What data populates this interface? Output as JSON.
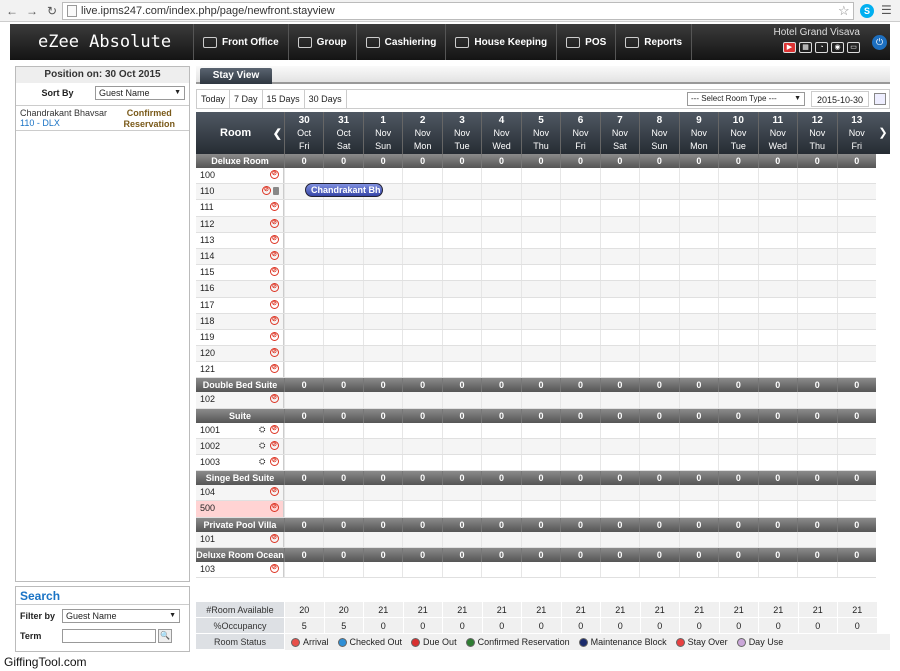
{
  "browser": {
    "url": "live.ipms247.com/index.php/page/newfront.stayview"
  },
  "app": {
    "logo": "eZee Absolute",
    "hotel_name": "Hotel Grand Visava",
    "nav": [
      {
        "label": "Front Office",
        "icon": "front-office-icon"
      },
      {
        "label": "Group",
        "icon": "group-icon"
      },
      {
        "label": "Cashiering",
        "icon": "cashiering-icon"
      },
      {
        "label": "House Keeping",
        "icon": "housekeeping-icon"
      },
      {
        "label": "POS",
        "icon": "pos-icon"
      },
      {
        "label": "Reports",
        "icon": "reports-icon"
      }
    ]
  },
  "left": {
    "position_label": "Position on: 30 Oct 2015",
    "sort_label": "Sort By",
    "sort_value": "Guest Name",
    "reservation": {
      "guest": "Chandrakant Bhavsar",
      "room": "110 - DLX",
      "status_line1": "Confirmed",
      "status_line2": "Reservation"
    }
  },
  "search": {
    "title": "Search",
    "filter_label": "Filter by",
    "filter_value": "Guest Name",
    "term_label": "Term",
    "term_value": ""
  },
  "stayview": {
    "tab": "Stay View",
    "view_buttons": [
      "Today",
      "7 Day",
      "15 Days",
      "30 Days"
    ],
    "room_type_placeholder": "--- Select Room Type ---",
    "date": "2015-10-30",
    "room_header": "Room",
    "days": [
      {
        "n": "30",
        "m": "Oct",
        "w": "Fri"
      },
      {
        "n": "31",
        "m": "Oct",
        "w": "Sat"
      },
      {
        "n": "1",
        "m": "Nov",
        "w": "Sun"
      },
      {
        "n": "2",
        "m": "Nov",
        "w": "Mon"
      },
      {
        "n": "3",
        "m": "Nov",
        "w": "Tue"
      },
      {
        "n": "4",
        "m": "Nov",
        "w": "Wed"
      },
      {
        "n": "5",
        "m": "Nov",
        "w": "Thu"
      },
      {
        "n": "6",
        "m": "Nov",
        "w": "Fri"
      },
      {
        "n": "7",
        "m": "Nov",
        "w": "Sat"
      },
      {
        "n": "8",
        "m": "Nov",
        "w": "Sun"
      },
      {
        "n": "9",
        "m": "Nov",
        "w": "Mon"
      },
      {
        "n": "10",
        "m": "Nov",
        "w": "Tue"
      },
      {
        "n": "11",
        "m": "Nov",
        "w": "Wed"
      },
      {
        "n": "12",
        "m": "Nov",
        "w": "Thu"
      },
      {
        "n": "13",
        "m": "Nov",
        "w": "Fri"
      }
    ],
    "groups": [
      {
        "name": "Deluxe Room",
        "counts": [
          "0",
          "0",
          "0",
          "0",
          "0",
          "0",
          "0",
          "0",
          "0",
          "0",
          "0",
          "0",
          "0",
          "0",
          "0"
        ],
        "rooms": [
          {
            "no": "100"
          },
          {
            "no": "110",
            "lock": true
          },
          {
            "no": "111"
          },
          {
            "no": "112"
          },
          {
            "no": "113"
          },
          {
            "no": "114"
          },
          {
            "no": "115"
          },
          {
            "no": "116"
          },
          {
            "no": "117"
          },
          {
            "no": "118"
          },
          {
            "no": "119"
          },
          {
            "no": "120"
          },
          {
            "no": "121"
          }
        ]
      },
      {
        "name": "Double Bed Suite",
        "counts": [
          "0",
          "0",
          "0",
          "0",
          "0",
          "0",
          "0",
          "0",
          "0",
          "0",
          "0",
          "0",
          "0",
          "0",
          "0"
        ],
        "rooms": [
          {
            "no": "102"
          }
        ]
      },
      {
        "name": "Suite",
        "counts": [
          "0",
          "0",
          "0",
          "0",
          "0",
          "0",
          "0",
          "0",
          "0",
          "0",
          "0",
          "0",
          "0",
          "0",
          "0"
        ],
        "rooms": [
          {
            "no": "1001",
            "link": true
          },
          {
            "no": "1002",
            "link": true
          },
          {
            "no": "1003",
            "link": true
          }
        ]
      },
      {
        "name": "Singe Bed Suite",
        "counts": [
          "0",
          "0",
          "0",
          "0",
          "0",
          "0",
          "0",
          "0",
          "0",
          "0",
          "0",
          "0",
          "0",
          "0",
          "0"
        ],
        "rooms": [
          {
            "no": "104"
          },
          {
            "no": "500",
            "highlight": true
          }
        ]
      },
      {
        "name": "Private Pool Villa",
        "counts": [
          "0",
          "0",
          "0",
          "0",
          "0",
          "0",
          "0",
          "0",
          "0",
          "0",
          "0",
          "0",
          "0",
          "0",
          "0"
        ],
        "rooms": [
          {
            "no": "101"
          }
        ]
      },
      {
        "name": "Deluxe Room Ocean",
        "counts": [
          "0",
          "0",
          "0",
          "0",
          "0",
          "0",
          "0",
          "0",
          "0",
          "0",
          "0",
          "0",
          "0",
          "0",
          "0"
        ],
        "rooms": [
          {
            "no": "103"
          }
        ]
      }
    ],
    "reservation_bar": "Chandrakant Bh",
    "stats": {
      "available_label": "#Room Available",
      "available": [
        "20",
        "20",
        "21",
        "21",
        "21",
        "21",
        "21",
        "21",
        "21",
        "21",
        "21",
        "21",
        "21",
        "21",
        "21"
      ],
      "occupancy_label": "%Occupancy",
      "occupancy": [
        "5",
        "5",
        "0",
        "0",
        "0",
        "0",
        "0",
        "0",
        "0",
        "0",
        "0",
        "0",
        "0",
        "0",
        "0"
      ],
      "status_label": "Room Status"
    },
    "legend": [
      {
        "label": "Arrival",
        "color": "#e8504a"
      },
      {
        "label": "Checked Out",
        "color": "#2f8fd6"
      },
      {
        "label": "Due Out",
        "color": "#d83030"
      },
      {
        "label": "Confirmed Reservation",
        "color": "#2e7d32"
      },
      {
        "label": "Maintenance Block",
        "color": "#1a2a6c"
      },
      {
        "label": "Stay Over",
        "color": "#e84040"
      },
      {
        "label": "Day Use",
        "color": "#c9a6d8"
      }
    ]
  },
  "watermark": "GiffingTool.com"
}
